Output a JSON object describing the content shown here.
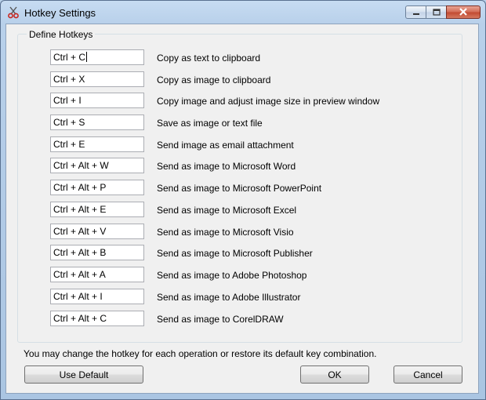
{
  "window": {
    "title": "Hotkey Settings",
    "app_icon": "scissors-icon",
    "controls": [
      "minimize-icon",
      "maximize-icon",
      "close-icon"
    ]
  },
  "group": {
    "label": "Define Hotkeys"
  },
  "hotkeys": [
    {
      "key": "Ctrl + C",
      "description": "Copy as text to clipboard"
    },
    {
      "key": "Ctrl + X",
      "description": "Copy as image to clipboard"
    },
    {
      "key": "Ctrl + I",
      "description": "Copy image and adjust image size in preview window"
    },
    {
      "key": "Ctrl + S",
      "description": "Save as image or text file"
    },
    {
      "key": "Ctrl + E",
      "description": "Send image as email attachment"
    },
    {
      "key": "Ctrl + Alt + W",
      "description": "Send as image to Microsoft Word"
    },
    {
      "key": "Ctrl + Alt + P",
      "description": "Send as image to Microsoft PowerPoint"
    },
    {
      "key": "Ctrl + Alt + E",
      "description": "Send as image to Microsoft Excel"
    },
    {
      "key": "Ctrl + Alt + V",
      "description": "Send as image to Microsoft Visio"
    },
    {
      "key": "Ctrl + Alt + B",
      "description": "Send as image to Microsoft Publisher"
    },
    {
      "key": "Ctrl + Alt + A",
      "description": "Send as image to Adobe Photoshop"
    },
    {
      "key": "Ctrl + Alt + I",
      "description": "Send as image to Adobe Illustrator"
    },
    {
      "key": "Ctrl + Alt + C",
      "description": "Send as image to CorelDRAW"
    }
  ],
  "hint": "You may change the hotkey for each operation or restore its default key combination.",
  "buttons": {
    "use_default": "Use Default",
    "ok": "OK",
    "cancel": "Cancel"
  },
  "colors": {
    "frame": "#b9d1ea",
    "client": "#f0f0f0",
    "close_button": "#c24b32"
  }
}
